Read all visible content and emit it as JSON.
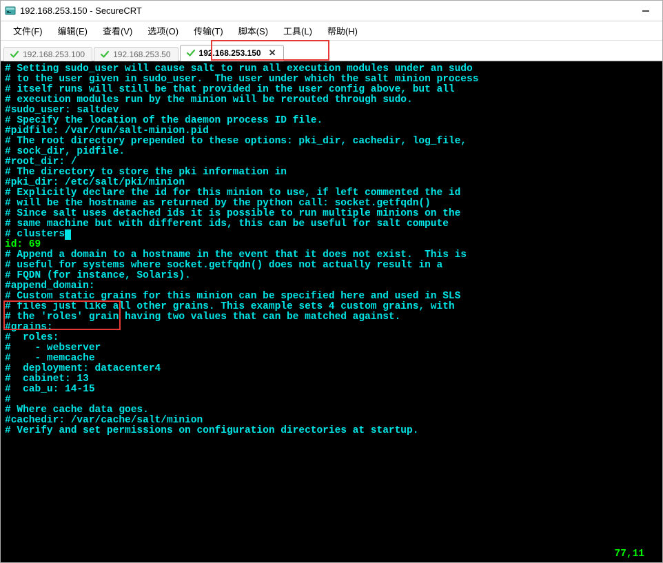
{
  "titlebar": {
    "title": "192.168.253.150 - SecureCRT"
  },
  "menubar": {
    "items": [
      "文件(F)",
      "编辑(E)",
      "查看(V)",
      "选项(O)",
      "传输(T)",
      "脚本(S)",
      "工具(L)",
      "帮助(H)"
    ]
  },
  "tabs": [
    {
      "label": "192.168.253.100",
      "active": false,
      "closable": false
    },
    {
      "label": "192.168.253.50",
      "active": false,
      "closable": false
    },
    {
      "label": "192.168.253.150",
      "active": true,
      "closable": true
    }
  ],
  "terminal": {
    "lines": [
      "# Setting sudo_user will cause salt to run all execution modules under an sudo",
      "# to the user given in sudo_user.  The user under which the salt minion process",
      "# itself runs will still be that provided in the user config above, but all",
      "# execution modules run by the minion will be rerouted through sudo.",
      "#sudo_user: saltdev",
      "",
      "# Specify the location of the daemon process ID file.",
      "#pidfile: /var/run/salt-minion.pid",
      "",
      "# The root directory prepended to these options: pki_dir, cachedir, log_file,",
      "# sock_dir, pidfile.",
      "#root_dir: /",
      "",
      "# The directory to store the pki information in",
      "#pki_dir: /etc/salt/pki/minion",
      "",
      "# Explicitly declare the id for this minion to use, if left commented the id",
      "# will be the hostname as returned by the python call: socket.getfqdn()",
      "# Since salt uses detached ids it is possible to run multiple minions on the",
      "# same machine but with different ids, this can be useful for salt compute",
      "# clusters.",
      "id: 69",
      "",
      "# Append a domain to a hostname in the event that it does not exist.  This is",
      "# useful for systems where socket.getfqdn() does not actually result in a",
      "# FQDN (for instance, Solaris).",
      "#append_domain:",
      "",
      "# Custom static grains for this minion can be specified here and used in SLS",
      "# files just like all other grains. This example sets 4 custom grains, with",
      "# the 'roles' grain having two values that can be matched against.",
      "#grains:",
      "#  roles:",
      "#    - webserver",
      "#    - memcache",
      "#  deployment: datacenter4",
      "#  cabinet: 13",
      "#  cab_u: 14-15",
      "#",
      "# Where cache data goes.",
      "#cachedir: /var/cache/salt/minion",
      "",
      "# Verify and set permissions on configuration directories at startup."
    ],
    "cursor_line_index": 20,
    "green_line_index": 21,
    "status_position": "77,11"
  }
}
